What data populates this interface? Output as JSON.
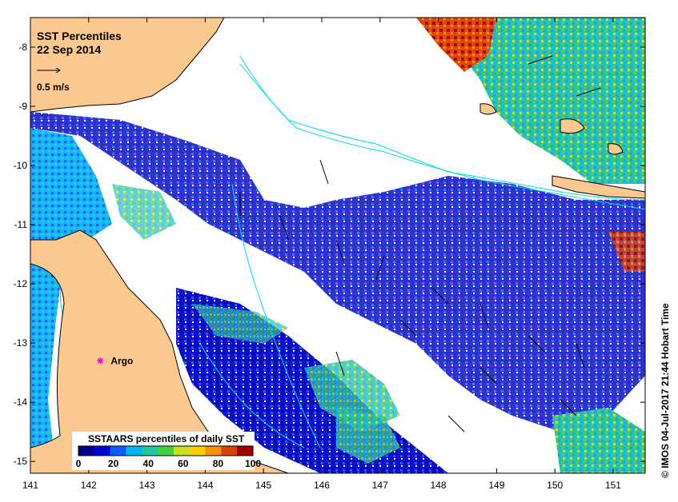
{
  "map": {
    "title": "SST Percentiles",
    "date": "22 Sep 2014",
    "scale_label": "0.5 m/s",
    "annotation_label": "Argo",
    "credit": "© IMOS 04-Jul-2017 21:44 Hobart Time",
    "x_ticks": [
      "141",
      "142",
      "143",
      "144",
      "145",
      "146",
      "147",
      "148",
      "149",
      "150",
      "151"
    ],
    "y_ticks": [
      "-8",
      "-9",
      "-10",
      "-11",
      "-12",
      "-13",
      "-14",
      "-15"
    ],
    "lon_range": [
      141,
      151.55
    ],
    "lat_range": [
      -15.2,
      -7.5
    ],
    "argo_location": {
      "lon": 142.2,
      "lat": -13.3
    },
    "colors": {
      "land": "#fbc98f",
      "coast": "#000000",
      "isobath": "#00e0e0",
      "argo_marker": "#ff00ff"
    }
  },
  "legend": {
    "title": "SSTAARS percentiles of daily SST",
    "labels": [
      "0",
      "20",
      "40",
      "60",
      "80",
      "100"
    ],
    "colors": [
      "#000090",
      "#0000d8",
      "#0a5cff",
      "#00b8f0",
      "#20c8a0",
      "#44d040",
      "#c8e020",
      "#f8d000",
      "#f89000",
      "#d84000",
      "#a00000"
    ]
  }
}
